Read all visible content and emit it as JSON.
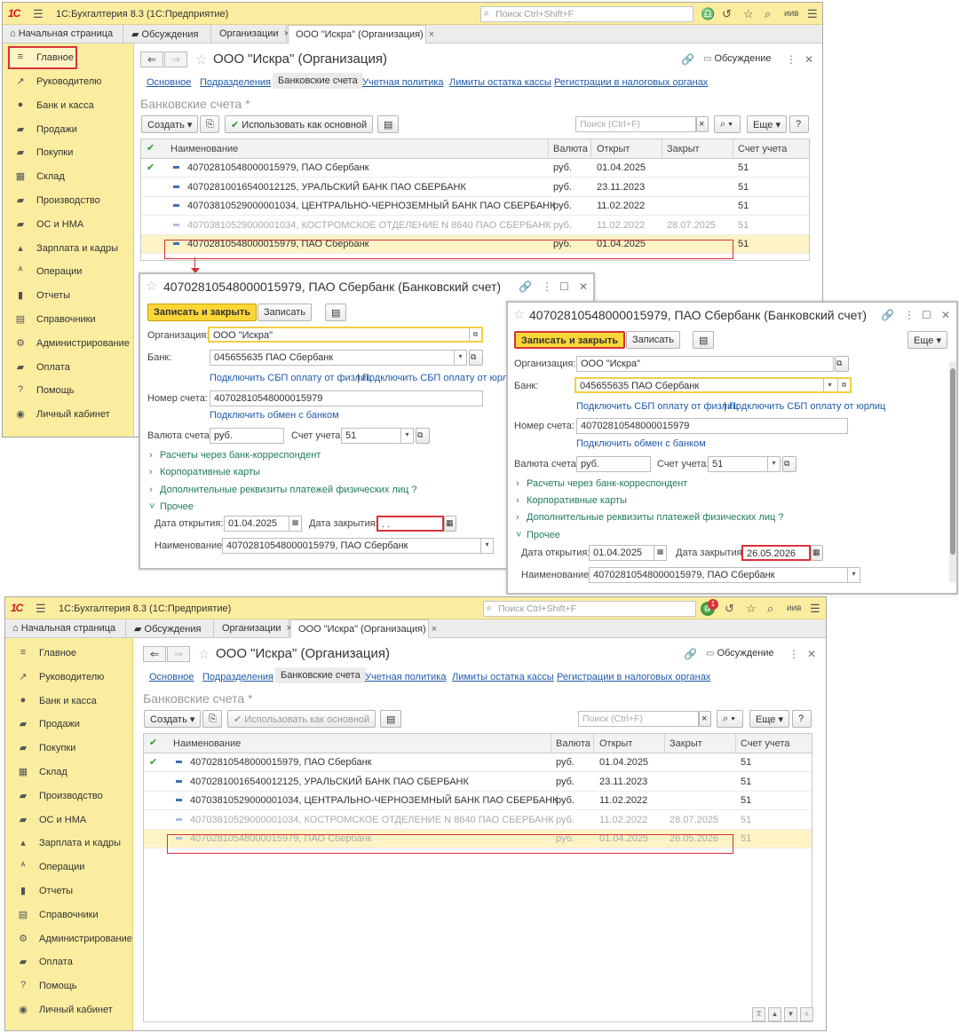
{
  "app": {
    "title": "1С:Бухгалтерия 8.3  (1С:Предприятие)",
    "search_placeholder": "Поиск Ctrl+Shift+F",
    "user": "иив",
    "notification_count": "1"
  },
  "tabs": [
    {
      "label": "Начальная страница"
    },
    {
      "label": "Обсуждения"
    },
    {
      "label": "Организации"
    },
    {
      "label": "ООО \"Искра\" (Организация)"
    }
  ],
  "sidebar": [
    {
      "label": "Главное",
      "icon": "≡"
    },
    {
      "label": "Руководителю",
      "icon": "↗"
    },
    {
      "label": "Банк и касса",
      "icon": "●"
    },
    {
      "label": "Продажи",
      "icon": "▰"
    },
    {
      "label": "Покупки",
      "icon": "▰"
    },
    {
      "label": "Склад",
      "icon": "▦"
    },
    {
      "label": "Производство",
      "icon": "▰"
    },
    {
      "label": "ОС и НМА",
      "icon": "▰"
    },
    {
      "label": "Зарплата и кадры",
      "icon": "▴"
    },
    {
      "label": "Операции",
      "icon": "ᴬ"
    },
    {
      "label": "Отчеты",
      "icon": "▮"
    },
    {
      "label": "Справочники",
      "icon": "▤"
    },
    {
      "label": "Администрирование",
      "icon": "⚙"
    },
    {
      "label": "Оплата",
      "icon": "▰"
    },
    {
      "label": "Помощь",
      "icon": "?"
    },
    {
      "label": "Личный кабинет",
      "icon": "◉"
    }
  ],
  "form": {
    "title": "ООО \"Искра\" (Организация)",
    "discussion": "Обсуждение",
    "links": [
      "Основное",
      "Подразделения",
      "Банковские счета",
      "Учетная политика",
      "Лимиты остатка кассы",
      "Регистрации в налоговых органах"
    ],
    "section": "Банковские счета *",
    "create": "Создать",
    "use_main": "Использовать как основной",
    "search_placeholder": "Поиск (Ctrl+F)",
    "more": "Еще"
  },
  "table": {
    "headers": [
      "Наименование",
      "Валюта",
      "Открыт",
      "Закрыт",
      "Счет учета"
    ],
    "rows": [
      {
        "name": "40702810548000015979, ПАО Сбербанк",
        "currency": "руб.",
        "opened": "01.04.2025",
        "closed": "",
        "account": "51"
      },
      {
        "name": "40702810016540012125, УРАЛЬСКИЙ БАНК ПАО СБЕРБАНК",
        "currency": "руб.",
        "opened": "23.11.2023",
        "closed": "",
        "account": "51"
      },
      {
        "name": "40703810529000001034, ЦЕНТРАЛЬНО-ЧЕРНОЗЕМНЫЙ БАНК ПАО СБЕРБАНК",
        "currency": "руб.",
        "opened": "11.02.2022",
        "closed": "",
        "account": "51"
      },
      {
        "name": "40703810529000001034, КОСТРОМСКОЕ ОТДЕЛЕНИЕ N 8640 ПАО СБЕРБАНК",
        "currency": "руб.",
        "opened": "11.02.2022",
        "closed": "28.07.2025",
        "account": "51"
      },
      {
        "name": "40702810548000015979, ПАО Сбербанк",
        "currency": "руб.",
        "opened": "01.04.2025",
        "closed": "",
        "account": "51"
      }
    ],
    "bottom_last_closed": "26.05.2026"
  },
  "dialog": {
    "title": "40702810548000015979, ПАО Сбербанк (Банковский счет)",
    "save_close": "Записать и закрыть",
    "save": "Записать",
    "more": "Еще",
    "org_label": "Организация:",
    "org_value": "ООО \"Искра\"",
    "bank_label": "Банк:",
    "bank_value": "045655635 ПАО Сбербанк",
    "sbp_individual": "Подключить СБП оплату от физлиц",
    "sbp_separator": "|",
    "sbp_legal": "Подключить СБП оплату от юрлиц",
    "account_label": "Номер счета:",
    "account_value": "40702810548000015979",
    "exchange_link": "Подключить обмен с банком",
    "currency_label": "Валюта счета:",
    "currency_value": "руб.",
    "ledger_label": "Счет учета:",
    "ledger_value": "51",
    "group_correspondent": "Расчеты через банк-корреспондент",
    "group_cards": "Корпоративные карты",
    "group_extra": "Дополнительные реквизиты платежей физических лиц",
    "group_extra_help": "?",
    "group_other": "Прочее",
    "open_label": "Дата открытия:",
    "open_value": "01.04.2025",
    "close_label": "Дата закрытия:",
    "close_value_empty": " .  .",
    "close_value_filled": "26.05.2026",
    "name_label": "Наименование:",
    "name_value": "40702810548000015979, ПАО Сбербанк"
  }
}
